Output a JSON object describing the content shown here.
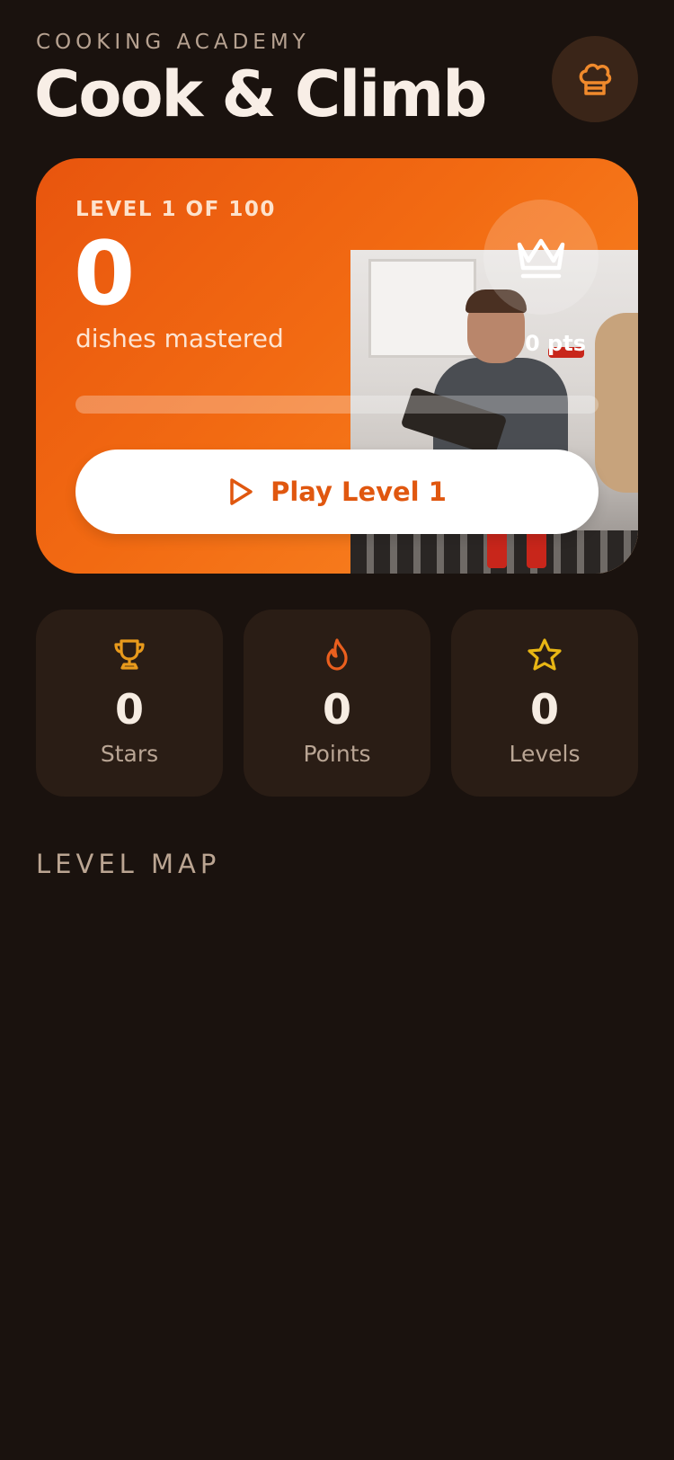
{
  "header": {
    "eyebrow": "COOKING ACADEMY",
    "title": "Cook & Climb",
    "profile_icon": "chef-hat-icon"
  },
  "hero": {
    "level_label": "LEVEL 1 OF 100",
    "count": "0",
    "count_label": "dishes mastered",
    "badge_icon": "crown-icon",
    "points_label": "0 pts",
    "progress_fraction": 0,
    "play_button_label": "Play Level 1",
    "play_icon": "play-icon",
    "accent": "#e8550e"
  },
  "stats": [
    {
      "icon": "trophy-icon",
      "value": "0",
      "label": "Stars",
      "color": "#e89a1c"
    },
    {
      "icon": "flame-icon",
      "value": "0",
      "label": "Points",
      "color": "#ea5f1e"
    },
    {
      "icon": "star-icon",
      "value": "0",
      "label": "Levels",
      "color": "#e8b614"
    }
  ],
  "level_map": {
    "title": "LEVEL MAP"
  }
}
